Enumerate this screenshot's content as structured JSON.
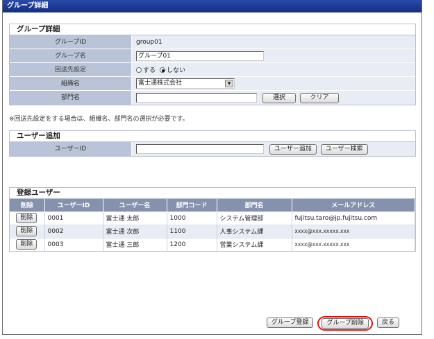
{
  "window": {
    "title": "グループ詳細"
  },
  "group_detail": {
    "section_title": "グループ詳細",
    "fields": {
      "group_id_label": "グループID",
      "group_id_value": "group01",
      "group_name_label": "グループ名",
      "group_name_value": "グループ01",
      "routing_label": "回送先設定",
      "routing_on": "する",
      "routing_off": "しない",
      "routing_selected": "しない",
      "org_label": "組織名",
      "org_value": "富士通株式会社",
      "dept_label": "部門名",
      "dept_value": "",
      "select_button": "選択",
      "clear_button": "クリア"
    },
    "note": "※回送先設定をする場合は、組織名、部門名の選択が必要です。"
  },
  "user_add": {
    "section_title": "ユーザー追加",
    "user_id_label": "ユーザーID",
    "user_id_value": "",
    "add_button": "ユーザー追加",
    "search_button": "ユーザー検索"
  },
  "registered_users": {
    "section_title": "登録ユーザー",
    "columns": [
      "削除",
      "ユーザーID",
      "ユーザー名",
      "部門コード",
      "部門名",
      "メールアドレス"
    ],
    "rows": [
      {
        "delete_label": "削除",
        "user_id": "0001",
        "user_name": "富士通 太郎",
        "dept_code": "1000",
        "dept_name": "システム管理部",
        "email": "fujitsu.taro@jp.fujitsu.com"
      },
      {
        "delete_label": "削除",
        "user_id": "0002",
        "user_name": "富士通 次郎",
        "dept_code": "1100",
        "dept_name": "人事システム課",
        "email": "xxxx@xxx.xxxxx.xxx"
      },
      {
        "delete_label": "削除",
        "user_id": "0003",
        "user_name": "富士通 三郎",
        "dept_code": "1200",
        "dept_name": "営業システム課",
        "email": "xxxx@xxx.xxxxx.xxx"
      }
    ]
  },
  "footer": {
    "register_button": "グループ登録",
    "delete_button": "グループ削除",
    "back_button": "戻る"
  },
  "colors": {
    "titlebar": "#16338f",
    "label_bg": "#b9c4d8",
    "field_bg": "#e8ecf4",
    "header_bg": "#8592ad",
    "highlight": "#e01010"
  }
}
